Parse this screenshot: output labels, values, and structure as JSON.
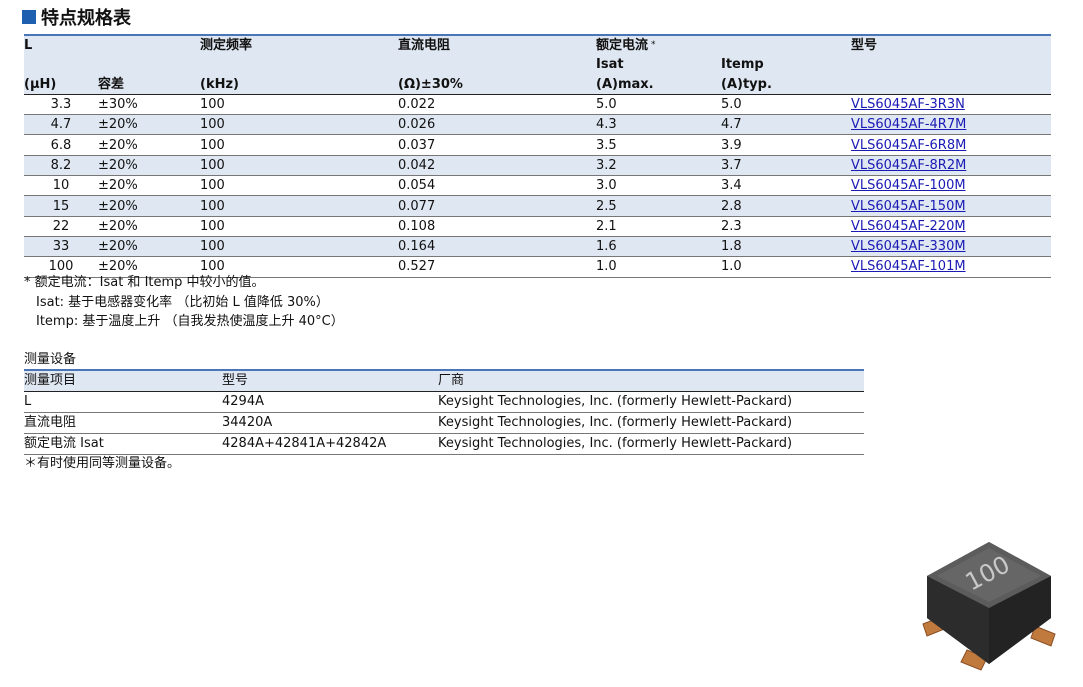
{
  "title": "特点规格表",
  "spec": {
    "headers": {
      "l": "L",
      "l_unit": "(μH)",
      "tolerance": "容差",
      "freq": "测定频率",
      "freq_unit": "(kHz)",
      "dcr": "直流电阻",
      "dcr_unit": "(Ω)±30%",
      "rated": "额定电流",
      "rated_star": "*",
      "isat": "Isat",
      "isat_unit": "(A)max.",
      "itemp": "Itemp",
      "itemp_unit": "(A)typ.",
      "model": "型号"
    },
    "rows": [
      {
        "l": "3.3",
        "tol": "±30%",
        "freq": "100",
        "dcr": "0.022",
        "isat": "5.0",
        "itemp": "5.0",
        "model": "VLS6045AF-3R3N"
      },
      {
        "l": "4.7",
        "tol": "±20%",
        "freq": "100",
        "dcr": "0.026",
        "isat": "4.3",
        "itemp": "4.7",
        "model": "VLS6045AF-4R7M"
      },
      {
        "l": "6.8",
        "tol": "±20%",
        "freq": "100",
        "dcr": "0.037",
        "isat": "3.5",
        "itemp": "3.9",
        "model": "VLS6045AF-6R8M"
      },
      {
        "l": "8.2",
        "tol": "±20%",
        "freq": "100",
        "dcr": "0.042",
        "isat": "3.2",
        "itemp": "3.7",
        "model": "VLS6045AF-8R2M"
      },
      {
        "l": "10",
        "tol": "±20%",
        "freq": "100",
        "dcr": "0.054",
        "isat": "3.0",
        "itemp": "3.4",
        "model": "VLS6045AF-100M"
      },
      {
        "l": "15",
        "tol": "±20%",
        "freq": "100",
        "dcr": "0.077",
        "isat": "2.5",
        "itemp": "2.8",
        "model": "VLS6045AF-150M"
      },
      {
        "l": "22",
        "tol": "±20%",
        "freq": "100",
        "dcr": "0.108",
        "isat": "2.1",
        "itemp": "2.3",
        "model": "VLS6045AF-220M"
      },
      {
        "l": "33",
        "tol": "±20%",
        "freq": "100",
        "dcr": "0.164",
        "isat": "1.6",
        "itemp": "1.8",
        "model": "VLS6045AF-330M"
      },
      {
        "l": "100",
        "tol": "±20%",
        "freq": "100",
        "dcr": "0.527",
        "isat": "1.0",
        "itemp": "1.0",
        "model": "VLS6045AF-101M"
      }
    ]
  },
  "notes": [
    "* 额定电流：Isat 和 Itemp 中较小的值。",
    "Isat: 基于电感器变化率 （比初始 L 值降低 30%）",
    "Itemp: 基于温度上升 （自我发热使温度上升 40°C）"
  ],
  "measurement": {
    "title": "测量设备",
    "headers": {
      "item": "测量项目",
      "model": "型号",
      "maker": "厂商"
    },
    "rows": [
      {
        "item": "L",
        "model": "4294A",
        "maker": "Keysight Technologies, Inc. (formerly Hewlett-Packard)"
      },
      {
        "item": "直流电阻",
        "model": "34420A",
        "maker": "Keysight Technologies, Inc. (formerly Hewlett-Packard)"
      },
      {
        "item": "额定电流 Isat",
        "model": "4284A+42841A+42842A",
        "maker": "Keysight Technologies, Inc. (formerly Hewlett-Packard)"
      }
    ],
    "note": "＊有时使用同等测量设备。"
  },
  "component_marking": "100"
}
